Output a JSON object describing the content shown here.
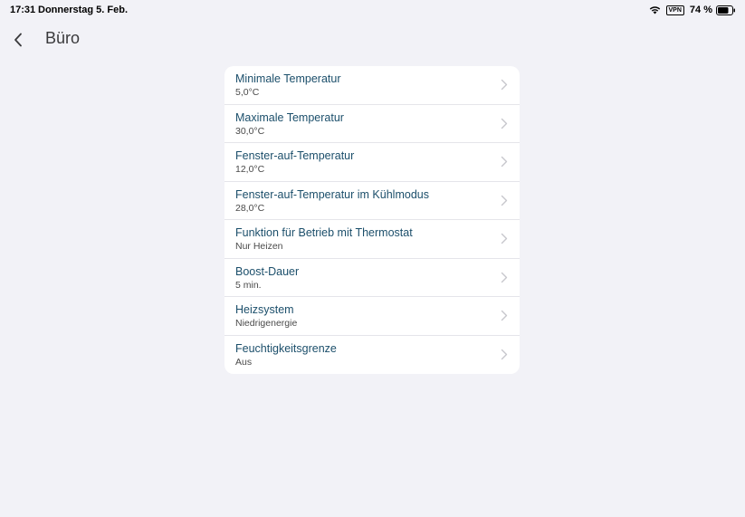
{
  "status_bar": {
    "time": "17:31",
    "date": "Donnerstag 5. Feb.",
    "vpn": "VPN",
    "battery": "74 %"
  },
  "header": {
    "title": "Büro"
  },
  "settings": [
    {
      "label": "Minimale Temperatur",
      "value": "5,0°C"
    },
    {
      "label": "Maximale Temperatur",
      "value": "30,0°C"
    },
    {
      "label": "Fenster-auf-Temperatur",
      "value": "12,0°C"
    },
    {
      "label": "Fenster-auf-Temperatur im Kühlmodus",
      "value": "28,0°C"
    },
    {
      "label": "Funktion für Betrieb mit Thermostat",
      "value": "Nur Heizen"
    },
    {
      "label": "Boost-Dauer",
      "value": "5 min."
    },
    {
      "label": "Heizsystem",
      "value": "Niedrigenergie"
    },
    {
      "label": "Feuchtigkeitsgrenze",
      "value": "Aus"
    }
  ],
  "colors": {
    "background": "#f2f2f7",
    "card": "#ffffff",
    "label": "#1c4f6b",
    "value": "#4a4a4a"
  }
}
